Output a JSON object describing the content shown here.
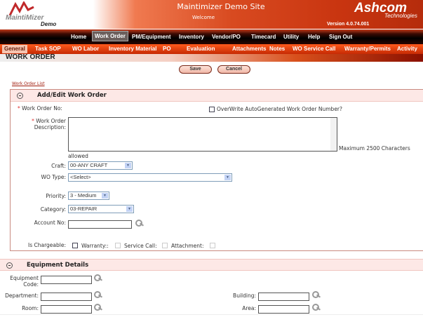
{
  "header": {
    "logo_text": "MaintiMizer",
    "logo_sub": "Demo",
    "title": "Maintimizer Demo Site",
    "welcome": "Welcome",
    "brand": "Ashcom",
    "brand_sub": "Technologies",
    "version": "Version 4.0.74.001"
  },
  "nav": [
    {
      "label": "Home"
    },
    {
      "label": "Work Order",
      "active": true
    },
    {
      "label": "PM/Equipment"
    },
    {
      "label": "Inventory"
    },
    {
      "label": "Vendor/PO"
    },
    {
      "label": "Timecard"
    },
    {
      "label": "Utility"
    },
    {
      "label": "Help"
    },
    {
      "label": "Sign Out"
    }
  ],
  "subtabs": [
    {
      "label": "General",
      "active": true
    },
    {
      "label": "Task SOP"
    },
    {
      "label": "WO Labor"
    },
    {
      "label": "Inventory Material"
    },
    {
      "label": "PO"
    },
    {
      "label": "Evaluation"
    },
    {
      "label": "Attachments"
    },
    {
      "label": "Notes"
    },
    {
      "label": "WO Service Call"
    },
    {
      "label": "Warranty/Permits"
    },
    {
      "label": "Activity"
    }
  ],
  "page_title": "WORK ORDER",
  "buttons": {
    "save": "Save",
    "cancel": "Cancel"
  },
  "work_order_list": "Work Order List",
  "form": {
    "section_title": "Add/Edit Work Order",
    "wo_no_label": "Work Order No:",
    "overwrite_label": "OverWrite AutoGenerated Work Order Number?",
    "desc_label_1": "Work Order",
    "desc_label_2": "Description:",
    "desc_value": "",
    "max_chars": "Maximum 2500 Characters",
    "allowed": "allowed",
    "craft_label": "Craft:",
    "craft_value": "00-ANY CRAFT",
    "wotype_label": "WO Type:",
    "wotype_value": "<Select>",
    "priority_label": "Priority:",
    "priority_value": "3 - Medium",
    "category_label": "Category:",
    "category_value": "03-REPAIR",
    "account_label": "Account No:",
    "account_value": "",
    "chargeable_label": "Is Chargeable:",
    "warranty_label": "Warranty::",
    "service_call_label": "Service Call:",
    "attachment_label": "Attachment:"
  },
  "equipment": {
    "section_title": "Equipment Details",
    "code_label_1": "Equipment",
    "code_label_2": "Code:",
    "department_label": "Department:",
    "building_label": "Building:",
    "room_label": "Room:",
    "area_label": "Area:"
  },
  "colors": {
    "brand_red": "#c93510",
    "required": "#e03030",
    "section_bg": "#fde8e6"
  }
}
